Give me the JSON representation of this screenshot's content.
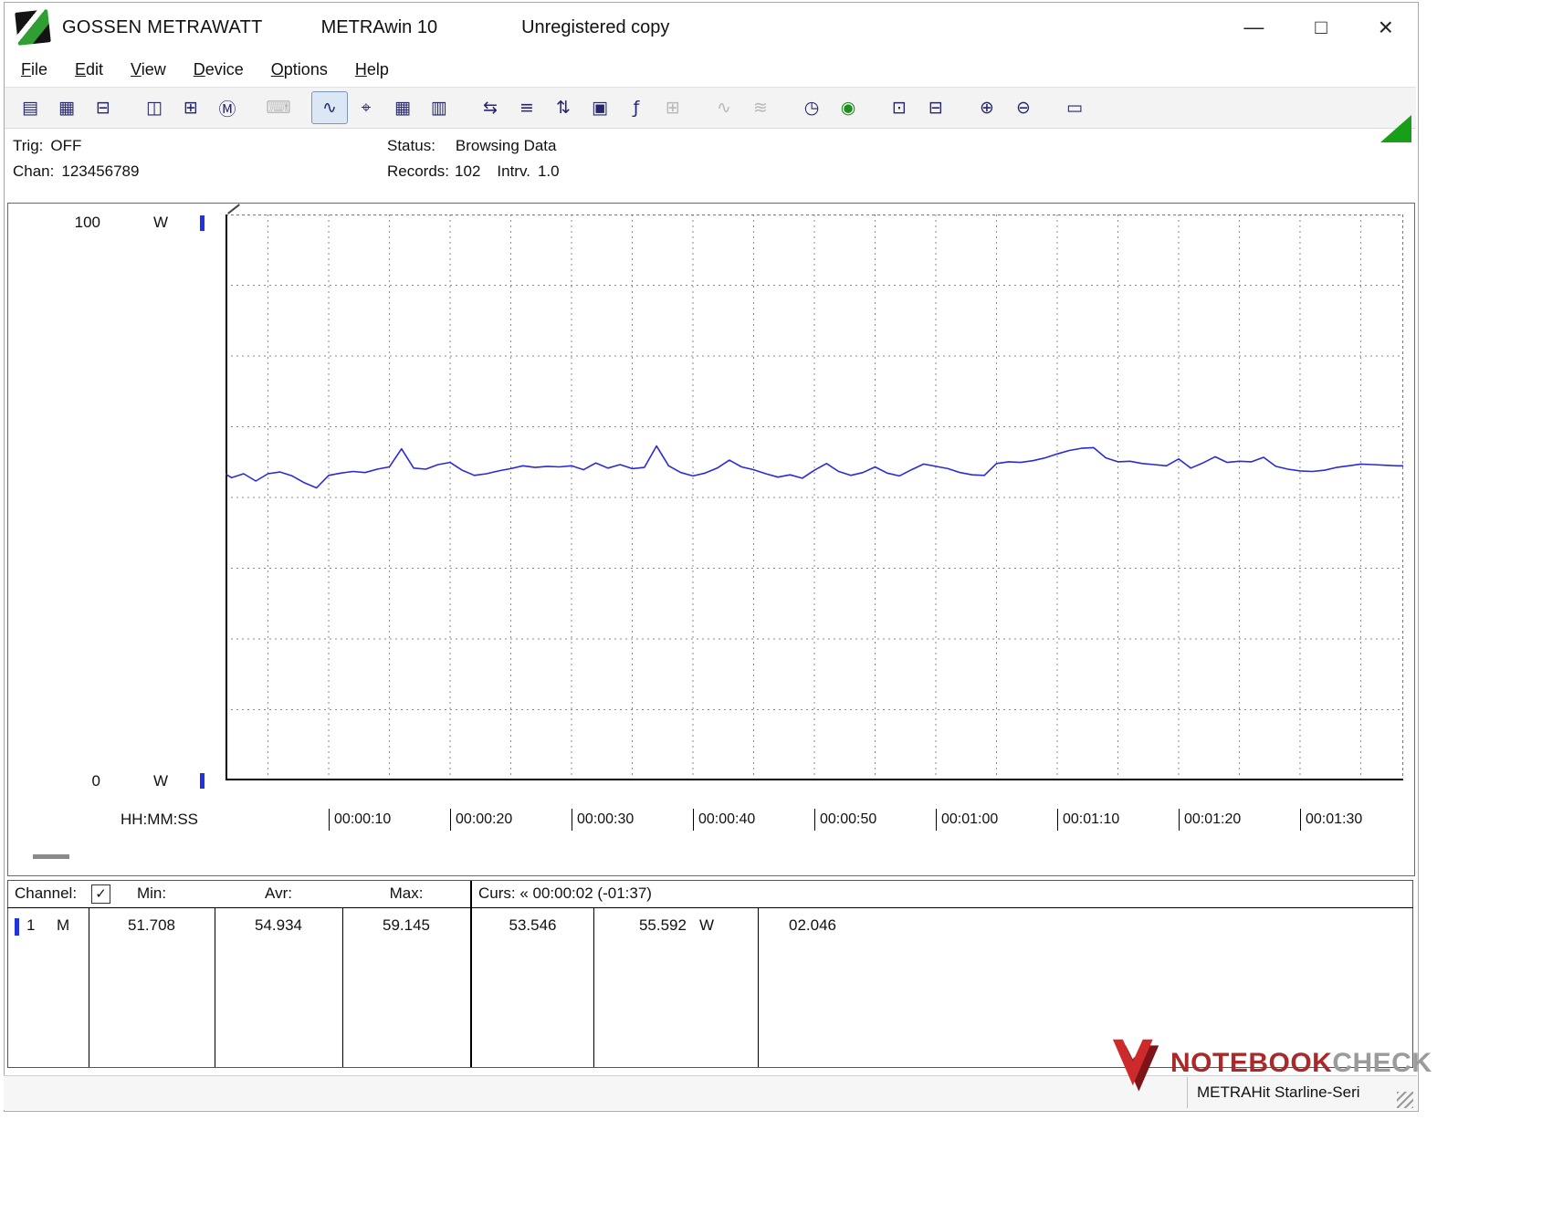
{
  "window": {
    "brand": "GOSSEN METRAWATT",
    "app": "METRAwin 10",
    "license": "Unregistered copy",
    "controls": {
      "minimize": "—",
      "maximize": "□",
      "close": "×"
    }
  },
  "menu": {
    "items": [
      {
        "label": "File"
      },
      {
        "label": "Edit"
      },
      {
        "label": "View"
      },
      {
        "label": "Device"
      },
      {
        "label": "Options"
      },
      {
        "label": "Help"
      }
    ]
  },
  "toolbar": {
    "buttons": [
      {
        "name": "save-data-icon",
        "glyph": "▤",
        "group": 1,
        "state": "normal"
      },
      {
        "name": "save-config-icon",
        "glyph": "▦",
        "group": 1,
        "state": "normal"
      },
      {
        "name": "open-file-icon",
        "glyph": "⊟",
        "group": 1,
        "state": "normal"
      },
      {
        "name": "device-read-icon",
        "glyph": "◫",
        "group": 2,
        "state": "normal"
      },
      {
        "name": "device-memory-icon",
        "glyph": "⊞",
        "group": 2,
        "state": "normal"
      },
      {
        "name": "device-mode-icon",
        "glyph": "Ⓜ",
        "group": 2,
        "state": "normal"
      },
      {
        "name": "numeric-display-icon",
        "glyph": "⌨",
        "group": 3,
        "state": "disabled"
      },
      {
        "name": "yt-chart-icon",
        "glyph": "∿",
        "group": 4,
        "state": "pressed"
      },
      {
        "name": "xy-chart-icon",
        "glyph": "⌖",
        "group": 4,
        "state": "normal"
      },
      {
        "name": "table-view-icon",
        "glyph": "▦",
        "group": 4,
        "state": "normal"
      },
      {
        "name": "bar-graph-icon",
        "glyph": "▥",
        "group": 4,
        "state": "normal"
      },
      {
        "name": "data-transfer-icon",
        "glyph": "⇆",
        "group": 5,
        "state": "normal"
      },
      {
        "name": "device-settings-icon",
        "glyph": "≡",
        "group": 5,
        "state": "normal"
      },
      {
        "name": "channel-list-icon",
        "glyph": "⇅",
        "group": 5,
        "state": "normal"
      },
      {
        "name": "monitor-icon",
        "glyph": "▣",
        "group": 5,
        "state": "normal"
      },
      {
        "name": "formula-icon",
        "glyph": "ƒ",
        "group": 5,
        "state": "normal"
      },
      {
        "name": "calculator-icon",
        "glyph": "⊞",
        "group": 5,
        "state": "disabled"
      },
      {
        "name": "analog-signal-icon",
        "glyph": "∿",
        "group": 6,
        "state": "disabled"
      },
      {
        "name": "wave-signal-icon",
        "glyph": "≋",
        "group": 6,
        "state": "disabled"
      },
      {
        "name": "clock-icon",
        "glyph": "◷",
        "group": 7,
        "state": "normal"
      },
      {
        "name": "stopwatch-icon",
        "glyph": "◉",
        "group": 7,
        "state": "normal",
        "color": "#1d8f1d"
      },
      {
        "name": "print-icon",
        "glyph": "⊡",
        "group": 8,
        "state": "normal"
      },
      {
        "name": "print-preview-icon",
        "glyph": "⊟",
        "group": 8,
        "state": "normal"
      },
      {
        "name": "zoom-in-icon",
        "glyph": "⊕",
        "group": 9,
        "state": "normal"
      },
      {
        "name": "zoom-out-icon",
        "glyph": "⊖",
        "group": 9,
        "state": "normal"
      },
      {
        "name": "note-icon",
        "glyph": "▭",
        "group": 10,
        "state": "normal"
      }
    ]
  },
  "status": {
    "trig_label": "Trig:",
    "trig_value": "OFF",
    "chan_label": "Chan:",
    "chan_value": "123456789",
    "status_label": "Status:",
    "status_value": "Browsing Data",
    "records_label": "Records:",
    "records_value": "102",
    "intrv_label": "Intrv.",
    "intrv_value": "1.0"
  },
  "chart": {
    "y_top": "100",
    "y_top_unit": "W",
    "y_bottom": "0",
    "y_bottom_unit": "W",
    "x_caption": "HH:MM:SS"
  },
  "chart_data": {
    "type": "line",
    "title": "",
    "ylabel": "W",
    "ylim": [
      0,
      100
    ],
    "xlabel": "HH:MM:SS",
    "x_view_range_s": [
      1.5,
      98.5
    ],
    "interval_s": 1.0,
    "records": 102,
    "grid": {
      "x_step_s": 5,
      "y_step_w": 12.5,
      "style": "dotted"
    },
    "x_tick_labels": [
      "00:00:10",
      "00:00:20",
      "00:00:30",
      "00:00:40",
      "00:00:50",
      "00:01:00",
      "00:01:10",
      "00:01:20",
      "00:01:30"
    ],
    "series": [
      {
        "name": "Channel 1 (M)",
        "unit": "W",
        "color": "#2b2bd6",
        "min": 51.708,
        "avg": 54.934,
        "max": 59.145,
        "values": [
          54.6,
          54.8,
          53.5,
          54.2,
          52.9,
          54.2,
          54.5,
          53.8,
          52.6,
          51.7,
          53.9,
          54.3,
          54.6,
          54.4,
          55.0,
          55.4,
          58.6,
          55.2,
          55.0,
          55.8,
          56.2,
          54.8,
          53.9,
          54.2,
          54.7,
          55.1,
          55.6,
          55.3,
          55.5,
          55.4,
          55.6,
          54.9,
          56.1,
          55.2,
          55.8,
          55.1,
          55.3,
          59.1,
          55.6,
          54.4,
          53.8,
          54.3,
          55.2,
          56.6,
          55.4,
          54.9,
          54.2,
          53.6,
          54.0,
          53.4,
          54.8,
          56.0,
          54.6,
          53.9,
          54.4,
          55.4,
          54.3,
          53.8,
          54.9,
          55.9,
          55.5,
          55.1,
          54.4,
          54.0,
          53.9,
          56.0,
          56.3,
          56.2,
          56.5,
          57.0,
          57.7,
          58.3,
          58.7,
          58.8,
          57.0,
          56.3,
          56.4,
          56.0,
          55.8,
          55.6,
          56.8,
          55.2,
          56.1,
          57.2,
          56.2,
          56.4,
          56.3,
          57.1,
          55.5,
          55.0,
          54.7,
          54.6,
          54.8,
          55.3,
          55.6,
          55.9,
          55.8,
          55.7,
          55.6,
          55.6
        ]
      }
    ],
    "cursors": {
      "cursor_time": "00:00:02",
      "window_span": "-01:37",
      "value_cursor_1": 53.546,
      "value_cursor_2": 55.592,
      "delta": 2.046
    }
  },
  "table": {
    "header": {
      "channel": "Channel:",
      "checkbox_checked": true,
      "check_glyph": "✓",
      "min": "Min:",
      "avr": "Avr:",
      "max": "Max:",
      "curs": "Curs: « 00:00:02 (-01:37)"
    },
    "row": {
      "channel_num": "1",
      "mode": "M",
      "min": "51.708",
      "avr": "54.934",
      "max": "59.145",
      "curs_a": "53.546",
      "curs_b": "55.592",
      "unit": "W",
      "delta": "02.046"
    }
  },
  "watermark": {
    "word1": "NOTEBOOK",
    "word2": "CHECK"
  },
  "statusbar": {
    "device": "METRAHit Starline-Seri"
  },
  "colors": {
    "series_blue": "#2b2bd6",
    "marker_blue": "#2233dd",
    "pressed_bg": "#dbe7f5",
    "toolbar_green": "#1d8f1d",
    "triangle_green": "#17a017",
    "watermark_red": "#a82a2a",
    "watermark_grey": "#9b9b9b"
  }
}
